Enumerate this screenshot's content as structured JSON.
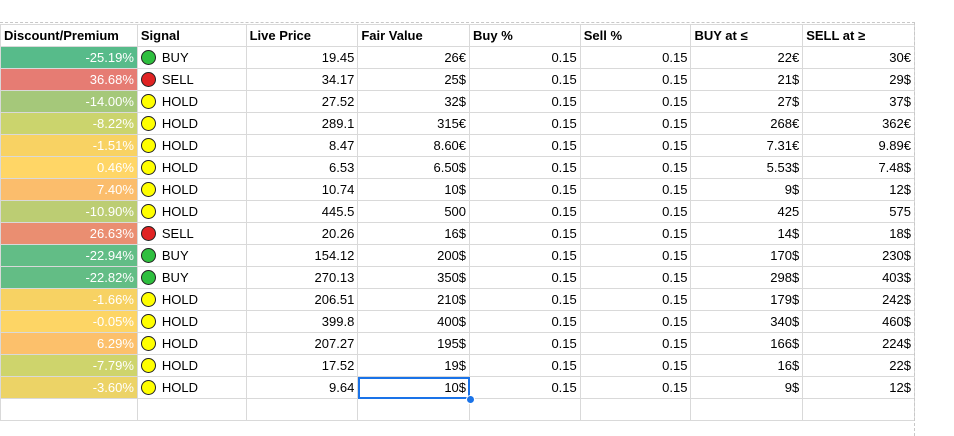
{
  "headers": [
    "Discount/Premium",
    "Signal",
    "Live Price",
    "Fair Value",
    "Buy %",
    "Sell %",
    "BUY at ≤",
    "SELL at ≥"
  ],
  "rows": [
    {
      "disc": "-25.19%",
      "color": "#57bb8a",
      "signal": "BUY",
      "dot": "green",
      "price": "19.45",
      "fair": "26€",
      "buy": "0.15",
      "sell": "0.15",
      "buyat": "22€",
      "sellat": "30€"
    },
    {
      "disc": "36.68%",
      "color": "#e67c73",
      "signal": "SELL",
      "dot": "red",
      "price": "34.17",
      "fair": "25$",
      "buy": "0.15",
      "sell": "0.15",
      "buyat": "21$",
      "sellat": "29$"
    },
    {
      "disc": "-14.00%",
      "color": "#a5c87a",
      "signal": "HOLD",
      "dot": "yellow",
      "price": "27.52",
      "fair": "32$",
      "buy": "0.15",
      "sell": "0.15",
      "buyat": "27$",
      "sellat": "37$"
    },
    {
      "disc": "-8.22%",
      "color": "#cbd46d",
      "signal": "HOLD",
      "dot": "yellow",
      "price": "289.1",
      "fair": "315€",
      "buy": "0.15",
      "sell": "0.15",
      "buyat": "268€",
      "sellat": "362€"
    },
    {
      "disc": "-1.51%",
      "color": "#f8d263",
      "signal": "HOLD",
      "dot": "yellow",
      "price": "8.47",
      "fair": "8.60€",
      "buy": "0.15",
      "sell": "0.15",
      "buyat": "7.31€",
      "sellat": "9.89€"
    },
    {
      "disc": "0.46%",
      "color": "#ffd666",
      "signal": "HOLD",
      "dot": "yellow",
      "price": "6.53",
      "fair": "6.50$",
      "buy": "0.15",
      "sell": "0.15",
      "buyat": "5.53$",
      "sellat": "7.48$"
    },
    {
      "disc": "7.40%",
      "color": "#fbbd6c",
      "signal": "HOLD",
      "dot": "yellow",
      "price": "10.74",
      "fair": "10$",
      "buy": "0.15",
      "sell": "0.15",
      "buyat": "9$",
      "sellat": "12$"
    },
    {
      "disc": "-10.90%",
      "color": "#bccd73",
      "signal": "HOLD",
      "dot": "yellow",
      "price": "445.5",
      "fair": "500",
      "buy": "0.15",
      "sell": "0.15",
      "buyat": "425",
      "sellat": "575"
    },
    {
      "disc": "26.63%",
      "color": "#ea8e71",
      "signal": "SELL",
      "dot": "red",
      "price": "20.26",
      "fair": "16$",
      "buy": "0.15",
      "sell": "0.15",
      "buyat": "14$",
      "sellat": "18$"
    },
    {
      "disc": "-22.94%",
      "color": "#62bd86",
      "signal": "BUY",
      "dot": "green",
      "price": "154.12",
      "fair": "200$",
      "buy": "0.15",
      "sell": "0.15",
      "buyat": "170$",
      "sellat": "230$"
    },
    {
      "disc": "-22.82%",
      "color": "#63bd85",
      "signal": "BUY",
      "dot": "green",
      "price": "270.13",
      "fair": "350$",
      "buy": "0.15",
      "sell": "0.15",
      "buyat": "298$",
      "sellat": "403$"
    },
    {
      "disc": "-1.66%",
      "color": "#f7d263",
      "signal": "HOLD",
      "dot": "yellow",
      "price": "206.51",
      "fair": "210$",
      "buy": "0.15",
      "sell": "0.15",
      "buyat": "179$",
      "sellat": "242$"
    },
    {
      "disc": "-0.05%",
      "color": "#fdd565",
      "signal": "HOLD",
      "dot": "yellow",
      "price": "399.8",
      "fair": "400$",
      "buy": "0.15",
      "sell": "0.15",
      "buyat": "340$",
      "sellat": "460$"
    },
    {
      "disc": "6.29%",
      "color": "#fcc06b",
      "signal": "HOLD",
      "dot": "yellow",
      "price": "207.27",
      "fair": "195$",
      "buy": "0.15",
      "sell": "0.15",
      "buyat": "166$",
      "sellat": "224$"
    },
    {
      "disc": "-7.79%",
      "color": "#ced46c",
      "signal": "HOLD",
      "dot": "yellow",
      "price": "17.52",
      "fair": "19$",
      "buy": "0.15",
      "sell": "0.15",
      "buyat": "16$",
      "sellat": "22$"
    },
    {
      "disc": "-3.60%",
      "color": "#ecd366",
      "signal": "HOLD",
      "dot": "yellow",
      "price": "9.64",
      "fair": "10$",
      "buy": "0.15",
      "sell": "0.15",
      "buyat": "9$",
      "sellat": "12$"
    }
  ],
  "selection": {
    "row": 15,
    "column": "fair",
    "handle_color": "#1a73e8"
  }
}
